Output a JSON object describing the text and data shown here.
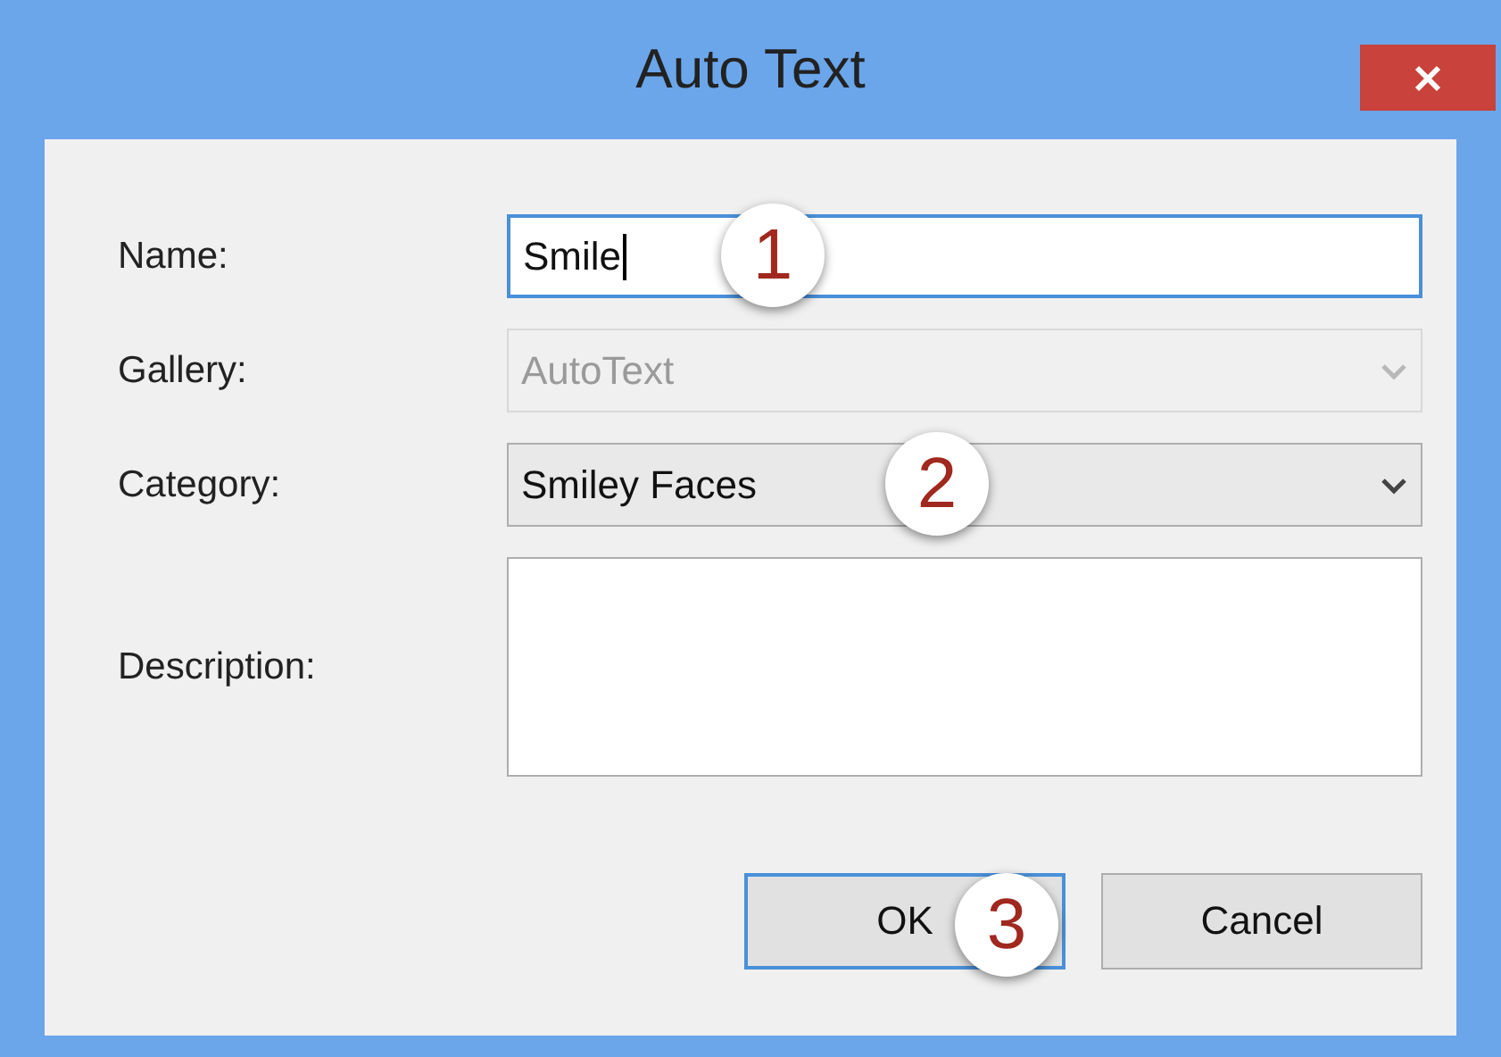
{
  "window": {
    "title": "Auto Text"
  },
  "fields": [
    {
      "label": "Name:",
      "kind": "text",
      "value": "Smile",
      "focused": true,
      "disabled": false,
      "callout": "1"
    },
    {
      "label": "Gallery:",
      "kind": "dropdown",
      "value": "AutoText",
      "focused": false,
      "disabled": true
    },
    {
      "label": "Category:",
      "kind": "dropdown",
      "value": "Smiley Faces",
      "focused": false,
      "disabled": false,
      "callout": "2"
    },
    {
      "label": "Description:",
      "kind": "textarea",
      "focused": false,
      "disabled": false
    }
  ],
  "buttons": [
    {
      "label": "OK",
      "focused": true,
      "callout": "3"
    },
    {
      "label": "Cancel",
      "focused": false
    }
  ]
}
